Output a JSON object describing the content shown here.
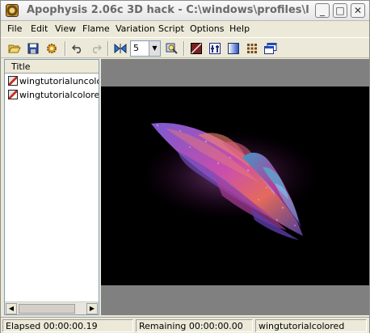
{
  "window": {
    "title": "Apophysis 2.06c 3D hack - C:\\windows\\profiles\\l",
    "minimize_glyph": "_",
    "maximize_glyph": "□",
    "close_glyph": "✕"
  },
  "menu": {
    "items": [
      "File",
      "Edit",
      "View",
      "Flame",
      "Variation",
      "Script",
      "Options",
      "Help"
    ]
  },
  "toolbar": {
    "quality_value": "5",
    "icons": [
      "open-icon",
      "save-icon",
      "gear-icon",
      "undo-icon",
      "redo-icon",
      "mirror-icon",
      "zoom-icon",
      "gradient-icon",
      "adjust-icon",
      "palette-icon",
      "grid-icon",
      "window-icon"
    ]
  },
  "list": {
    "column_header": "Title",
    "items": [
      {
        "label": "wingtutorialuncolored"
      },
      {
        "label": "wingtutorialcolored"
      }
    ]
  },
  "status": {
    "elapsed": "Elapsed 00:00:00.19",
    "remaining": "Remaining 00:00:00.00",
    "current_flame": "wingtutorialcolored"
  },
  "colors": {
    "render_background": "#000000",
    "preview_background": "#808080",
    "chrome": "#ece9d8"
  }
}
